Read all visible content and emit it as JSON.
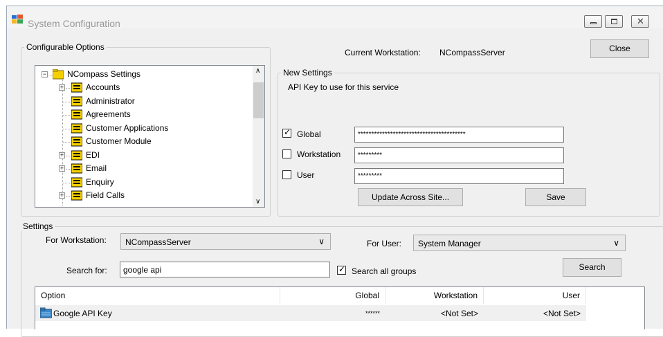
{
  "window": {
    "title": "System Configuration",
    "controls": [
      "minimize",
      "maximize",
      "close"
    ]
  },
  "configurable_options": {
    "label": "Configurable Options",
    "current_workstation_label": "Current Workstation:",
    "current_workstation_value": "NCompassServer",
    "close_label": "Close",
    "tree": {
      "root": "NCompass Settings",
      "items": [
        {
          "label": "Accounts",
          "expandable": true
        },
        {
          "label": "Administrator",
          "expandable": false
        },
        {
          "label": "Agreements",
          "expandable": false
        },
        {
          "label": "Customer Applications",
          "expandable": false
        },
        {
          "label": "Customer Module",
          "expandable": false
        },
        {
          "label": "EDI",
          "expandable": true
        },
        {
          "label": "Email",
          "expandable": true
        },
        {
          "label": "Enquiry",
          "expandable": false
        },
        {
          "label": "Field Calls",
          "expandable": true
        }
      ]
    }
  },
  "new_settings": {
    "label": "New Settings",
    "description": "API Key to use for this service",
    "global": {
      "label": "Global",
      "checked": true,
      "value": "****************************************"
    },
    "workstation": {
      "label": "Workstation",
      "checked": false,
      "value": "*********"
    },
    "user": {
      "label": "User",
      "checked": false,
      "value": "*********"
    },
    "update_label": "Update Across Site...",
    "save_label": "Save"
  },
  "settings": {
    "label": "Settings",
    "for_workstation_label": "For Workstation:",
    "for_workstation_value": "NCompassServer",
    "for_user_label": "For User:",
    "for_user_value": "System Manager",
    "search_for_label": "Search for:",
    "search_value": "google api",
    "search_all_groups_label": "Search all groups",
    "search_all_groups_checked": true,
    "search_label": "Search"
  },
  "grid": {
    "columns": [
      "Option",
      "Global",
      "Workstation",
      "User"
    ],
    "rows": [
      {
        "option": "Google API Key",
        "global": "******",
        "workstation": "<Not Set>",
        "user": "<Not Set>"
      }
    ]
  },
  "colors": {
    "window_bg": "#f0f0f0",
    "folder_yellow": "#f5d000",
    "selected_row": "#f0f0f0"
  }
}
